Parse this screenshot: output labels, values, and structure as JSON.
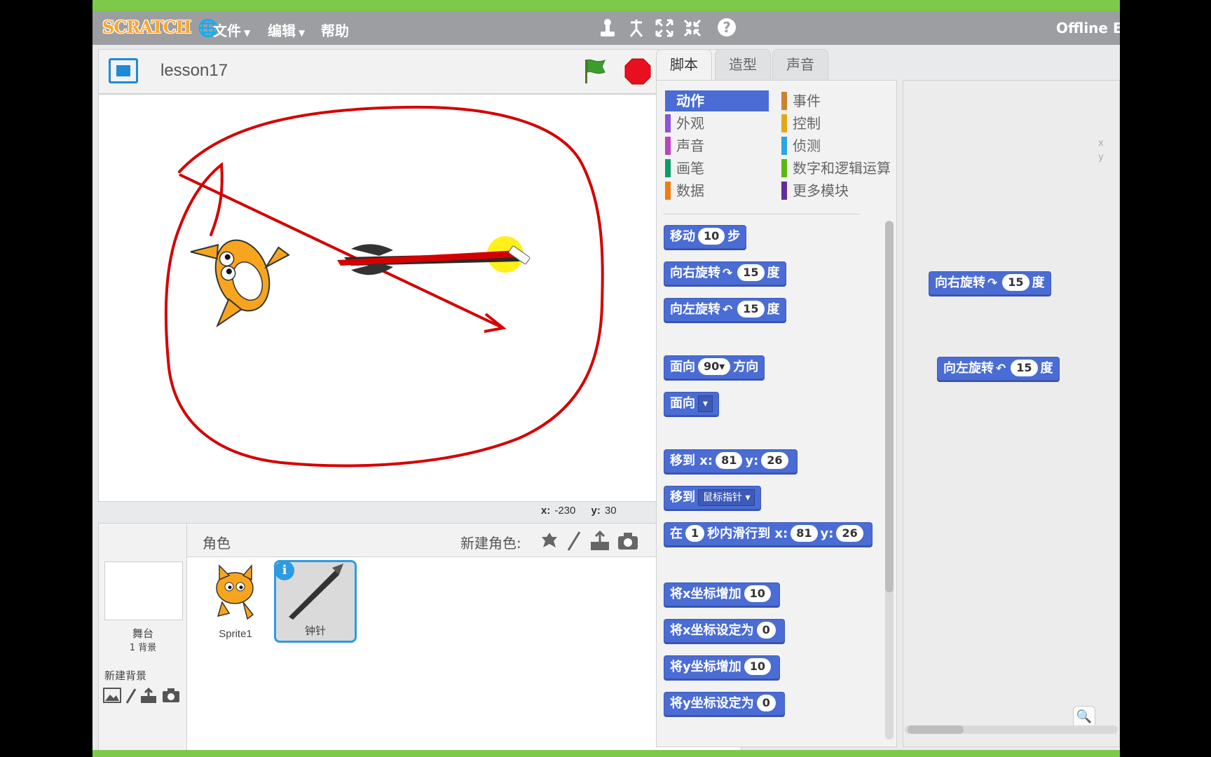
{
  "menu": {
    "logo": "SCRATCH",
    "file": "文件",
    "edit": "编辑",
    "help": "帮助",
    "offline_label": "Offline Ec"
  },
  "stage": {
    "project_title": "lesson17",
    "mouse_x_label": "x:",
    "mouse_x": "-230",
    "mouse_y_label": "y:",
    "mouse_y": "30"
  },
  "sprites_pane": {
    "header": "角色",
    "new_sprite_label": "新建角色:",
    "stage_name": "舞台",
    "stage_backdrop_count": "1 背景",
    "new_backdrop_label": "新建背景",
    "sprites": [
      {
        "name": "Sprite1",
        "selected": false
      },
      {
        "name": "钟针",
        "selected": true
      }
    ]
  },
  "tabs": [
    "脚本",
    "造型",
    "声音"
  ],
  "categories": {
    "left": [
      {
        "label": "动作",
        "color": "#4a6cd4",
        "active": true
      },
      {
        "label": "外观",
        "color": "#8a55d7"
      },
      {
        "label": "声音",
        "color": "#bb42c3"
      },
      {
        "label": "画笔",
        "color": "#0e9a6c"
      },
      {
        "label": "数据",
        "color": "#ee7d16"
      }
    ],
    "right": [
      {
        "label": "事件",
        "color": "#c88330"
      },
      {
        "label": "控制",
        "color": "#e1a91a"
      },
      {
        "label": "侦测",
        "color": "#2ca5e2"
      },
      {
        "label": "数字和逻辑运算",
        "color": "#5cb712"
      },
      {
        "label": "更多模块",
        "color": "#632d99"
      }
    ]
  },
  "blocks": {
    "move": {
      "pre": "移动",
      "value": "10",
      "post": "步"
    },
    "turn_right": {
      "pre": "向右旋转",
      "arrow": "↷",
      "value": "15",
      "post": "度"
    },
    "turn_left": {
      "pre": "向左旋转",
      "arrow": "↶",
      "value": "15",
      "post": "度"
    },
    "point_dir": {
      "pre": "面向",
      "value": "90▾",
      "post": "方向"
    },
    "point_towards": {
      "pre": "面向",
      "value": "▾"
    },
    "go_to_xy": {
      "pre": "移到",
      "x_label": "x:",
      "x": "81",
      "y_label": "y:",
      "y": "26"
    },
    "go_to": {
      "pre": "移到",
      "value": "鼠标指针 ▾"
    },
    "glide": {
      "pre": "在",
      "secs": "1",
      "mid": "秒内滑行到",
      "x_label": "x:",
      "x": "81",
      "y_label": "y:",
      "y": "26"
    },
    "change_x": {
      "pre": "将x坐标增加",
      "value": "10"
    },
    "set_x": {
      "pre": "将x坐标设定为",
      "value": "0"
    },
    "change_y": {
      "pre": "将y坐标增加",
      "value": "10"
    },
    "set_y": {
      "pre": "将y坐标设定为",
      "value": "0"
    }
  },
  "script_blocks": {
    "turn_right": {
      "pre": "向右旋转",
      "arrow": "↷",
      "value": "15",
      "post": "度"
    },
    "turn_left": {
      "pre": "向左旋转",
      "arrow": "↶",
      "value": "15",
      "post": "度"
    },
    "ghost_x": "x",
    "ghost_y": "y"
  },
  "colors": {
    "motion": "#4a6cd4",
    "annotation": "#d40000",
    "menubar": "#9c9ea2",
    "selection": "#2d9be0"
  }
}
